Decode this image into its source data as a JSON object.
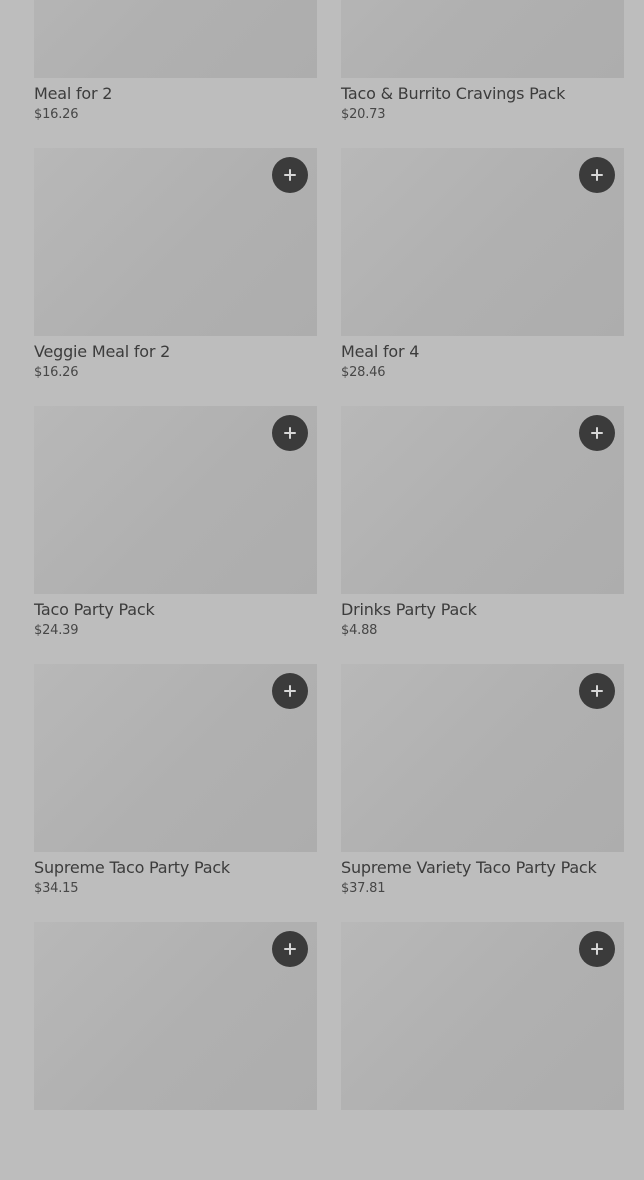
{
  "products": [
    {
      "name": "Meal for 2",
      "price": "$16.26",
      "add_icon": "plus-icon"
    },
    {
      "name": "Taco & Burrito Cravings Pack",
      "price": "$20.73",
      "add_icon": "plus-icon"
    },
    {
      "name": "Veggie Meal for 2",
      "price": "$16.26",
      "add_icon": "plus-icon"
    },
    {
      "name": "Meal for 4",
      "price": "$28.46",
      "add_icon": "plus-icon"
    },
    {
      "name": "Taco Party Pack",
      "price": "$24.39",
      "add_icon": "plus-icon"
    },
    {
      "name": "Drinks Party Pack",
      "price": "$4.88",
      "add_icon": "plus-icon"
    },
    {
      "name": "Supreme Taco Party Pack",
      "price": "$34.15",
      "add_icon": "plus-icon"
    },
    {
      "name": "Supreme Variety Taco Party Pack",
      "price": "$37.81",
      "add_icon": "plus-icon"
    },
    {
      "name": "",
      "price": "",
      "add_icon": "plus-icon"
    },
    {
      "name": "",
      "price": "",
      "add_icon": "plus-icon"
    }
  ],
  "colors": {
    "background": "#bdbdbd",
    "image_placeholder": "#b0b0b0",
    "add_button": "#3b3b3b",
    "text": "#3c3c3c"
  }
}
